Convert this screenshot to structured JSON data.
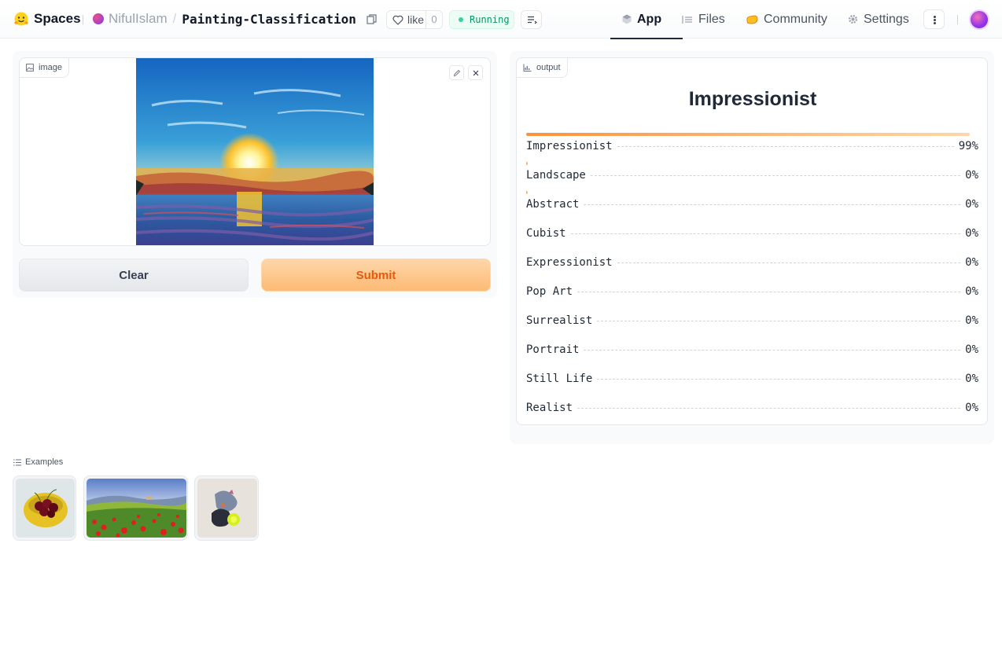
{
  "header": {
    "brand": "Spaces",
    "owner": "NifulIslam",
    "slash": "/",
    "repo_name": "Painting-Classification",
    "like_label": "like",
    "like_count": "0",
    "status": "Running",
    "tabs": [
      {
        "label": "App",
        "icon": "cube-icon",
        "active": true
      },
      {
        "label": "Files",
        "icon": "files-icon",
        "active": false
      },
      {
        "label": "Community",
        "icon": "community-icon",
        "active": false
      },
      {
        "label": "Settings",
        "icon": "gear-icon",
        "active": false
      }
    ]
  },
  "input": {
    "label": "image",
    "clear_label": "Clear",
    "submit_label": "Submit"
  },
  "output": {
    "label": "output",
    "prediction": "Impressionist",
    "confidences": [
      {
        "label": "Impressionist",
        "value": "99%",
        "fraction": 0.99
      },
      {
        "label": "Landscape",
        "value": "0%",
        "fraction": 0.004
      },
      {
        "label": "Abstract",
        "value": "0%",
        "fraction": 0.003
      },
      {
        "label": "Cubist",
        "value": "0%",
        "fraction": 0
      },
      {
        "label": "Expressionist",
        "value": "0%",
        "fraction": 0
      },
      {
        "label": "Pop Art",
        "value": "0%",
        "fraction": 0
      },
      {
        "label": "Surrealist",
        "value": "0%",
        "fraction": 0
      },
      {
        "label": "Portrait",
        "value": "0%",
        "fraction": 0
      },
      {
        "label": "Still Life",
        "value": "0%",
        "fraction": 0
      },
      {
        "label": "Realist",
        "value": "0%",
        "fraction": 0
      }
    ]
  },
  "examples": {
    "label": "Examples"
  },
  "colors": {
    "accent": "#fb923c",
    "submit_text": "#ea580c",
    "status_green": "#059669"
  }
}
